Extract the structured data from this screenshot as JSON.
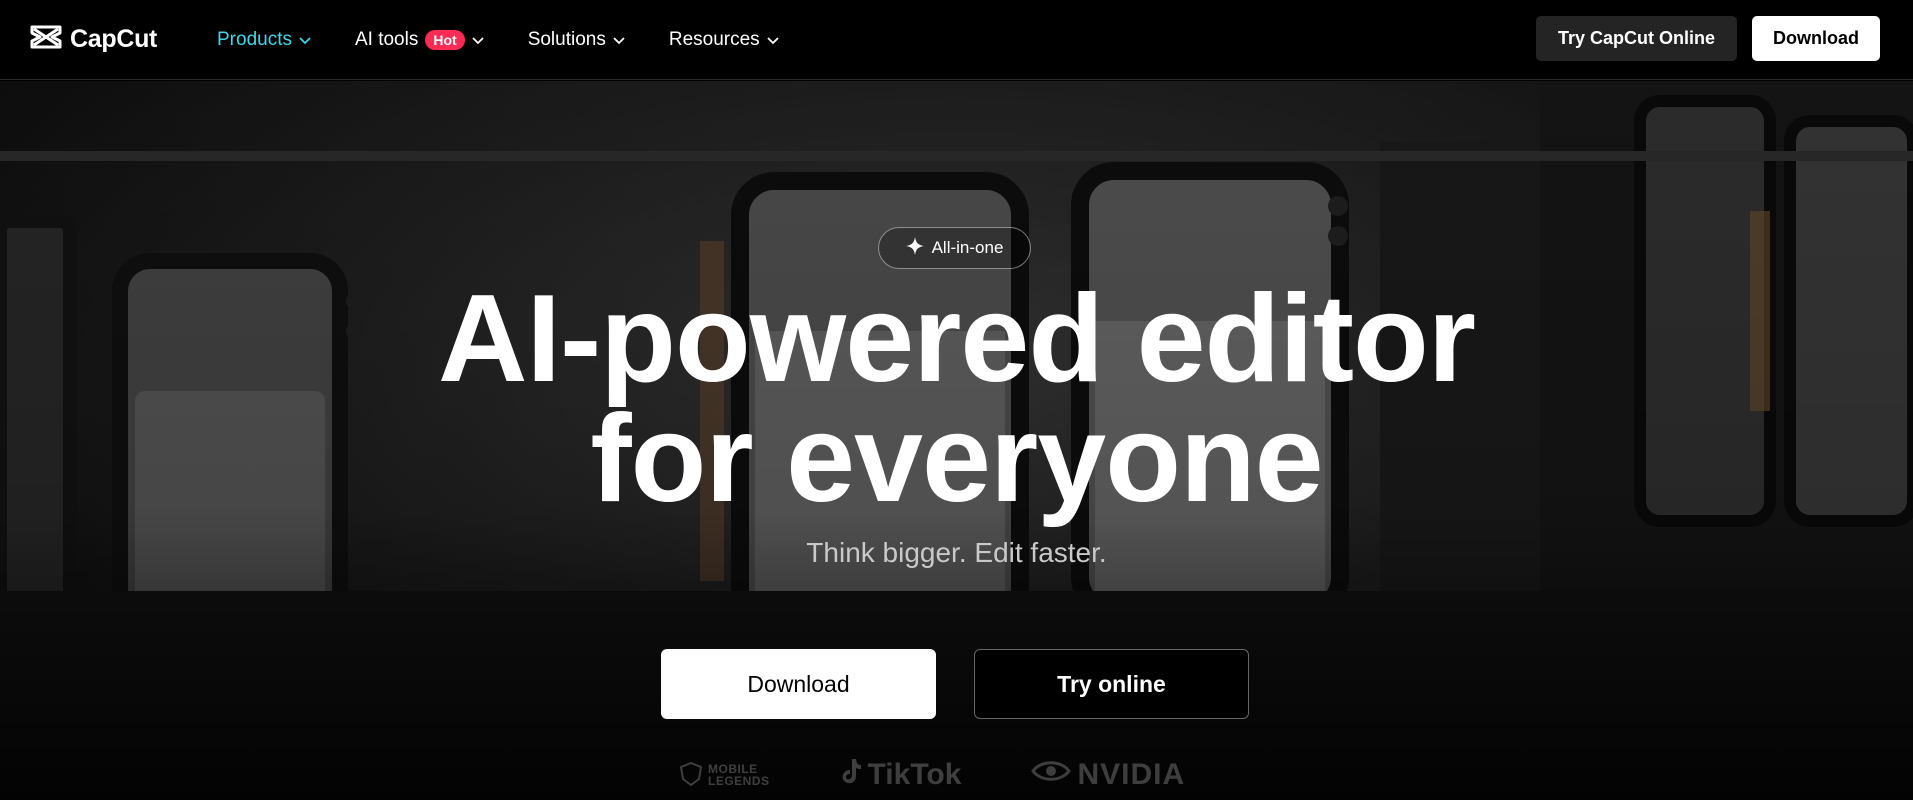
{
  "nav": {
    "logo_text": "CapCut",
    "menu": [
      {
        "label": "Products",
        "active": true
      },
      {
        "label": "AI tools",
        "badge": "Hot"
      },
      {
        "label": "Solutions"
      },
      {
        "label": "Resources"
      }
    ],
    "try_online_label": "Try CapCut Online",
    "download_label": "Download"
  },
  "hero": {
    "pill_label": "All-in-one",
    "headline_line1": "AI-powered editor",
    "headline_line2": "for everyone",
    "subhead": "Think bigger. Edit faster.",
    "download_label": "Download",
    "try_online_label": "Try online"
  },
  "partners": {
    "mobile_legends_line1": "MOBILE",
    "mobile_legends_line2": "LEGENDS",
    "tiktok": "TikTok",
    "nvidia": "NVIDIA"
  },
  "colors": {
    "accent": "#3fd6e8",
    "hot_badge": "#fe2c55"
  }
}
